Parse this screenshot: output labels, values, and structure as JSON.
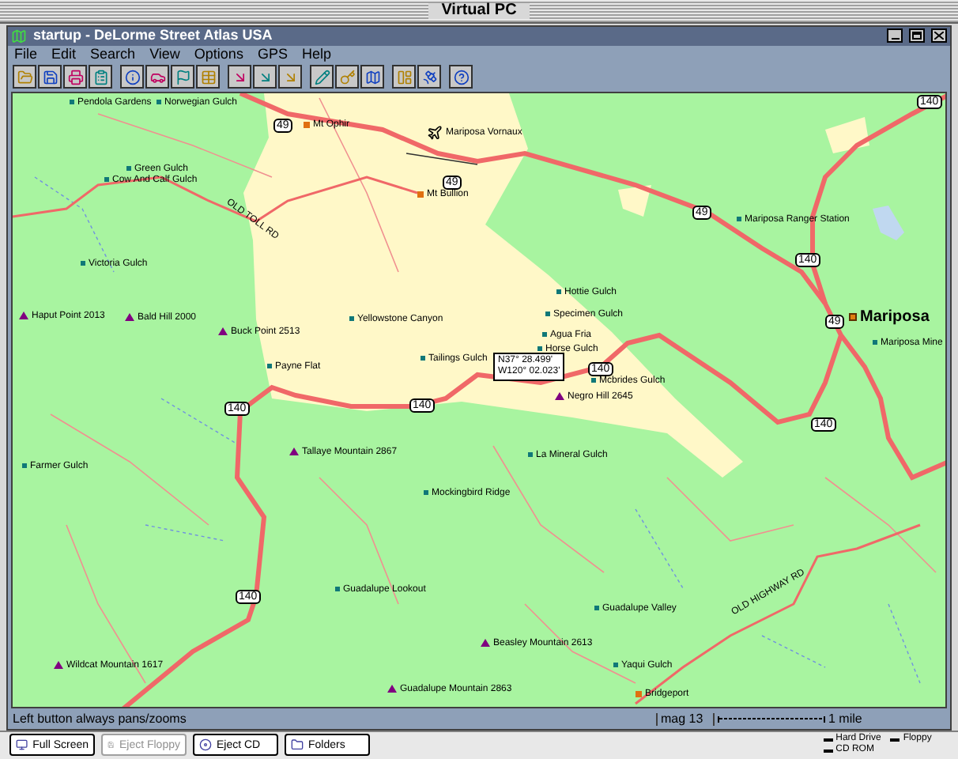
{
  "vpc_window": {
    "title": "Virtual PC"
  },
  "app_window": {
    "title": "startup - DeLorme Street Atlas USA"
  },
  "menu": [
    "File",
    "Edit",
    "Search",
    "View",
    "Options",
    "GPS",
    "Help"
  ],
  "map": {
    "places": [
      {
        "name": "Pendola Gardens",
        "kind": "locale"
      },
      {
        "name": "Norwegian Gulch",
        "kind": "locale"
      },
      {
        "name": "Mt Ophir",
        "kind": "town"
      },
      {
        "name": "Mariposa Vornaux",
        "kind": "airport"
      },
      {
        "name": "Green Gulch",
        "kind": "locale"
      },
      {
        "name": "Cow And Calf Gulch",
        "kind": "locale"
      },
      {
        "name": "Mt Bullion",
        "kind": "town"
      },
      {
        "name": "Victoria Gulch",
        "kind": "locale"
      },
      {
        "name": "Haput Point 2013",
        "kind": "peak"
      },
      {
        "name": "Bald Hill 2000",
        "kind": "peak"
      },
      {
        "name": "Buck Point 2513",
        "kind": "peak"
      },
      {
        "name": "Yellowstone Canyon",
        "kind": "locale"
      },
      {
        "name": "Payne Flat",
        "kind": "locale"
      },
      {
        "name": "Tailings Gulch",
        "kind": "locale"
      },
      {
        "name": "Hottie Gulch",
        "kind": "locale"
      },
      {
        "name": "Specimen Gulch",
        "kind": "locale"
      },
      {
        "name": "Agua Fria",
        "kind": "locale"
      },
      {
        "name": "Horse Gulch",
        "kind": "locale"
      },
      {
        "name": "Mcbrides Gulch",
        "kind": "locale"
      },
      {
        "name": "Negro Hill 2645",
        "kind": "peak"
      },
      {
        "name": "Mariposa Ranger Station",
        "kind": "locale"
      },
      {
        "name": "Mariposa",
        "kind": "city"
      },
      {
        "name": "Mariposa Mine",
        "kind": "locale"
      },
      {
        "name": "Tallaye Mountain 2867",
        "kind": "peak"
      },
      {
        "name": "Farmer Gulch",
        "kind": "locale"
      },
      {
        "name": "Mockingbird Ridge",
        "kind": "locale"
      },
      {
        "name": "La Mineral Gulch",
        "kind": "locale"
      },
      {
        "name": "Guadalupe Lookout",
        "kind": "locale"
      },
      {
        "name": "Guadalupe Valley",
        "kind": "locale"
      },
      {
        "name": "Beasley Mountain 2613",
        "kind": "peak"
      },
      {
        "name": "Yaqui Gulch",
        "kind": "locale"
      },
      {
        "name": "Wildcat Mountain 1617",
        "kind": "peak"
      },
      {
        "name": "Guadalupe Mountain 2863",
        "kind": "peak"
      },
      {
        "name": "Bridgeport",
        "kind": "town"
      }
    ],
    "shields": [
      "49",
      "49",
      "140",
      "49",
      "140",
      "49",
      "140",
      "140",
      "140",
      "140",
      "140"
    ],
    "road_labels": [
      "OLD TOLL RD",
      "OLD HIGHWAY RD"
    ],
    "pointer_readout": [
      "N37° 28.499'",
      "W120° 02.023'"
    ]
  },
  "status_bar": {
    "hint": "Left button always pans/zooms",
    "magnification": "mag 13",
    "scale": "1 mile"
  },
  "vpc_bar": {
    "buttons": [
      {
        "label": "Full Screen",
        "disabled": false
      },
      {
        "label": "Eject Floppy",
        "disabled": true
      },
      {
        "label": "Eject CD",
        "disabled": false
      },
      {
        "label": "Folders",
        "disabled": false
      }
    ],
    "legend": [
      "Hard Drive",
      "Floppy",
      "CD ROM"
    ]
  }
}
